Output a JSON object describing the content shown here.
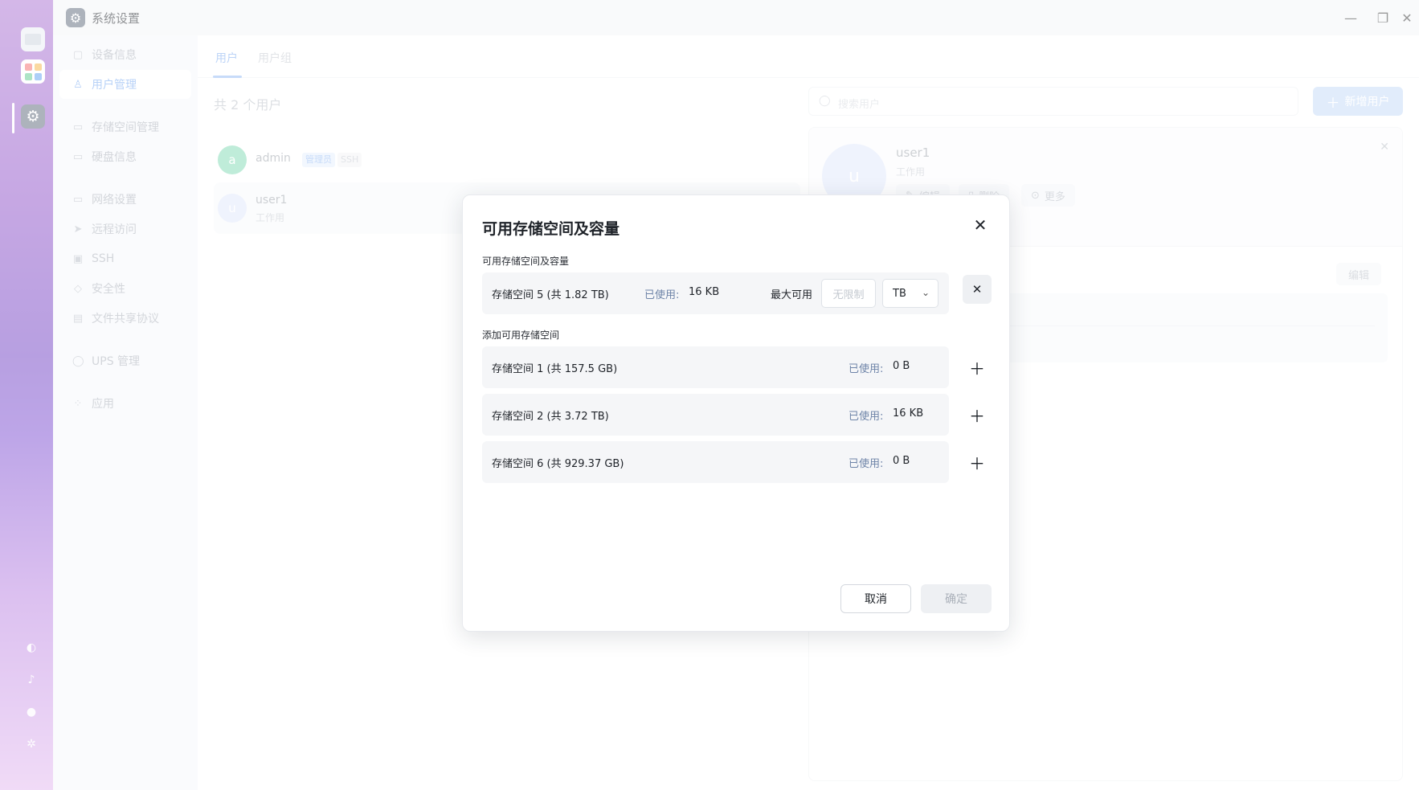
{
  "dock": {
    "apps": [
      {
        "icon": "monitor-icon"
      },
      {
        "icon": "app-grid-icon"
      },
      {
        "icon": "gear-icon",
        "active": true
      }
    ],
    "system_icons": [
      "network-icon",
      "bell-icon",
      "user-icon",
      "settings-icon"
    ]
  },
  "window": {
    "title": "系统设置",
    "controls": {
      "minimize": "—",
      "maximize": "❐",
      "close": "✕"
    }
  },
  "sidebar": {
    "groups": [
      [
        {
          "label": "设备信息",
          "icon": "device-icon",
          "glyph": "▢"
        },
        {
          "label": "用户管理",
          "icon": "user-manage-icon",
          "glyph": "♙",
          "active": true
        }
      ],
      [
        {
          "label": "存储空间管理",
          "icon": "storage-icon",
          "glyph": "▭"
        },
        {
          "label": "硬盘信息",
          "icon": "disk-icon",
          "glyph": "▭"
        }
      ],
      [
        {
          "label": "网络设置",
          "icon": "network-settings-icon",
          "glyph": "▭"
        },
        {
          "label": "远程访问",
          "icon": "remote-icon",
          "glyph": "➤"
        },
        {
          "label": "SSH",
          "icon": "ssh-icon",
          "glyph": "▣"
        },
        {
          "label": "安全性",
          "icon": "shield-icon",
          "glyph": "◇"
        },
        {
          "label": "文件共享协议",
          "icon": "file-share-icon",
          "glyph": "▤"
        }
      ],
      [
        {
          "label": "UPS 管理",
          "icon": "ups-icon",
          "glyph": "◯"
        }
      ],
      [
        {
          "label": "应用",
          "icon": "apps-icon",
          "glyph": "⁘"
        }
      ]
    ]
  },
  "tabs": [
    {
      "label": "用户",
      "active": true
    },
    {
      "label": "用户组",
      "active": false
    }
  ],
  "users": {
    "count_label": "共 2 个用户",
    "list": [
      {
        "initial": "a",
        "name": "admin",
        "badges": [
          "管理员",
          "SSH"
        ],
        "subtitle": "",
        "avatar_color": "#7fd9b2"
      },
      {
        "initial": "u",
        "name": "user1",
        "badges": [],
        "subtitle": "工作用",
        "avatar_color": "#dfe6fb"
      }
    ]
  },
  "search": {
    "placeholder": "搜索用户",
    "icon": "search-icon"
  },
  "add_user": {
    "label": "新增用户",
    "icon": "plus-icon"
  },
  "detail": {
    "initial": "u",
    "name": "user1",
    "subtitle": "工作用",
    "actions": [
      {
        "label": "编辑",
        "icon": "edit-icon"
      },
      {
        "label": "删除",
        "icon": "delete-icon"
      },
      {
        "label": "更多",
        "icon": "more-icon"
      }
    ],
    "edit_label": "编辑"
  },
  "modal": {
    "title": "可用存储空间及容量",
    "section_current": "可用存储空间及容量",
    "current": {
      "name": "存储空间 5 (共 1.82 TB)",
      "used_label": "已使用:",
      "used_value": "16 KB",
      "max_label": "最大可用",
      "limit_placeholder": "无限制",
      "unit": "TB"
    },
    "section_add": "添加可用存储空间",
    "available": [
      {
        "name": "存储空间 1 (共 157.5 GB)",
        "used_label": "已使用:",
        "used_value": "0 B"
      },
      {
        "name": "存储空间 2 (共 3.72 TB)",
        "used_label": "已使用:",
        "used_value": "16 KB"
      },
      {
        "name": "存储空间 6 (共 929.37 GB)",
        "used_label": "已使用:",
        "used_value": "0 B"
      }
    ],
    "cancel_label": "取消",
    "ok_label": "确定"
  },
  "colors": {
    "accent": "#7aa9ef",
    "primary_disabled": "#c2d8f7",
    "used_label": "#6e84a8"
  }
}
